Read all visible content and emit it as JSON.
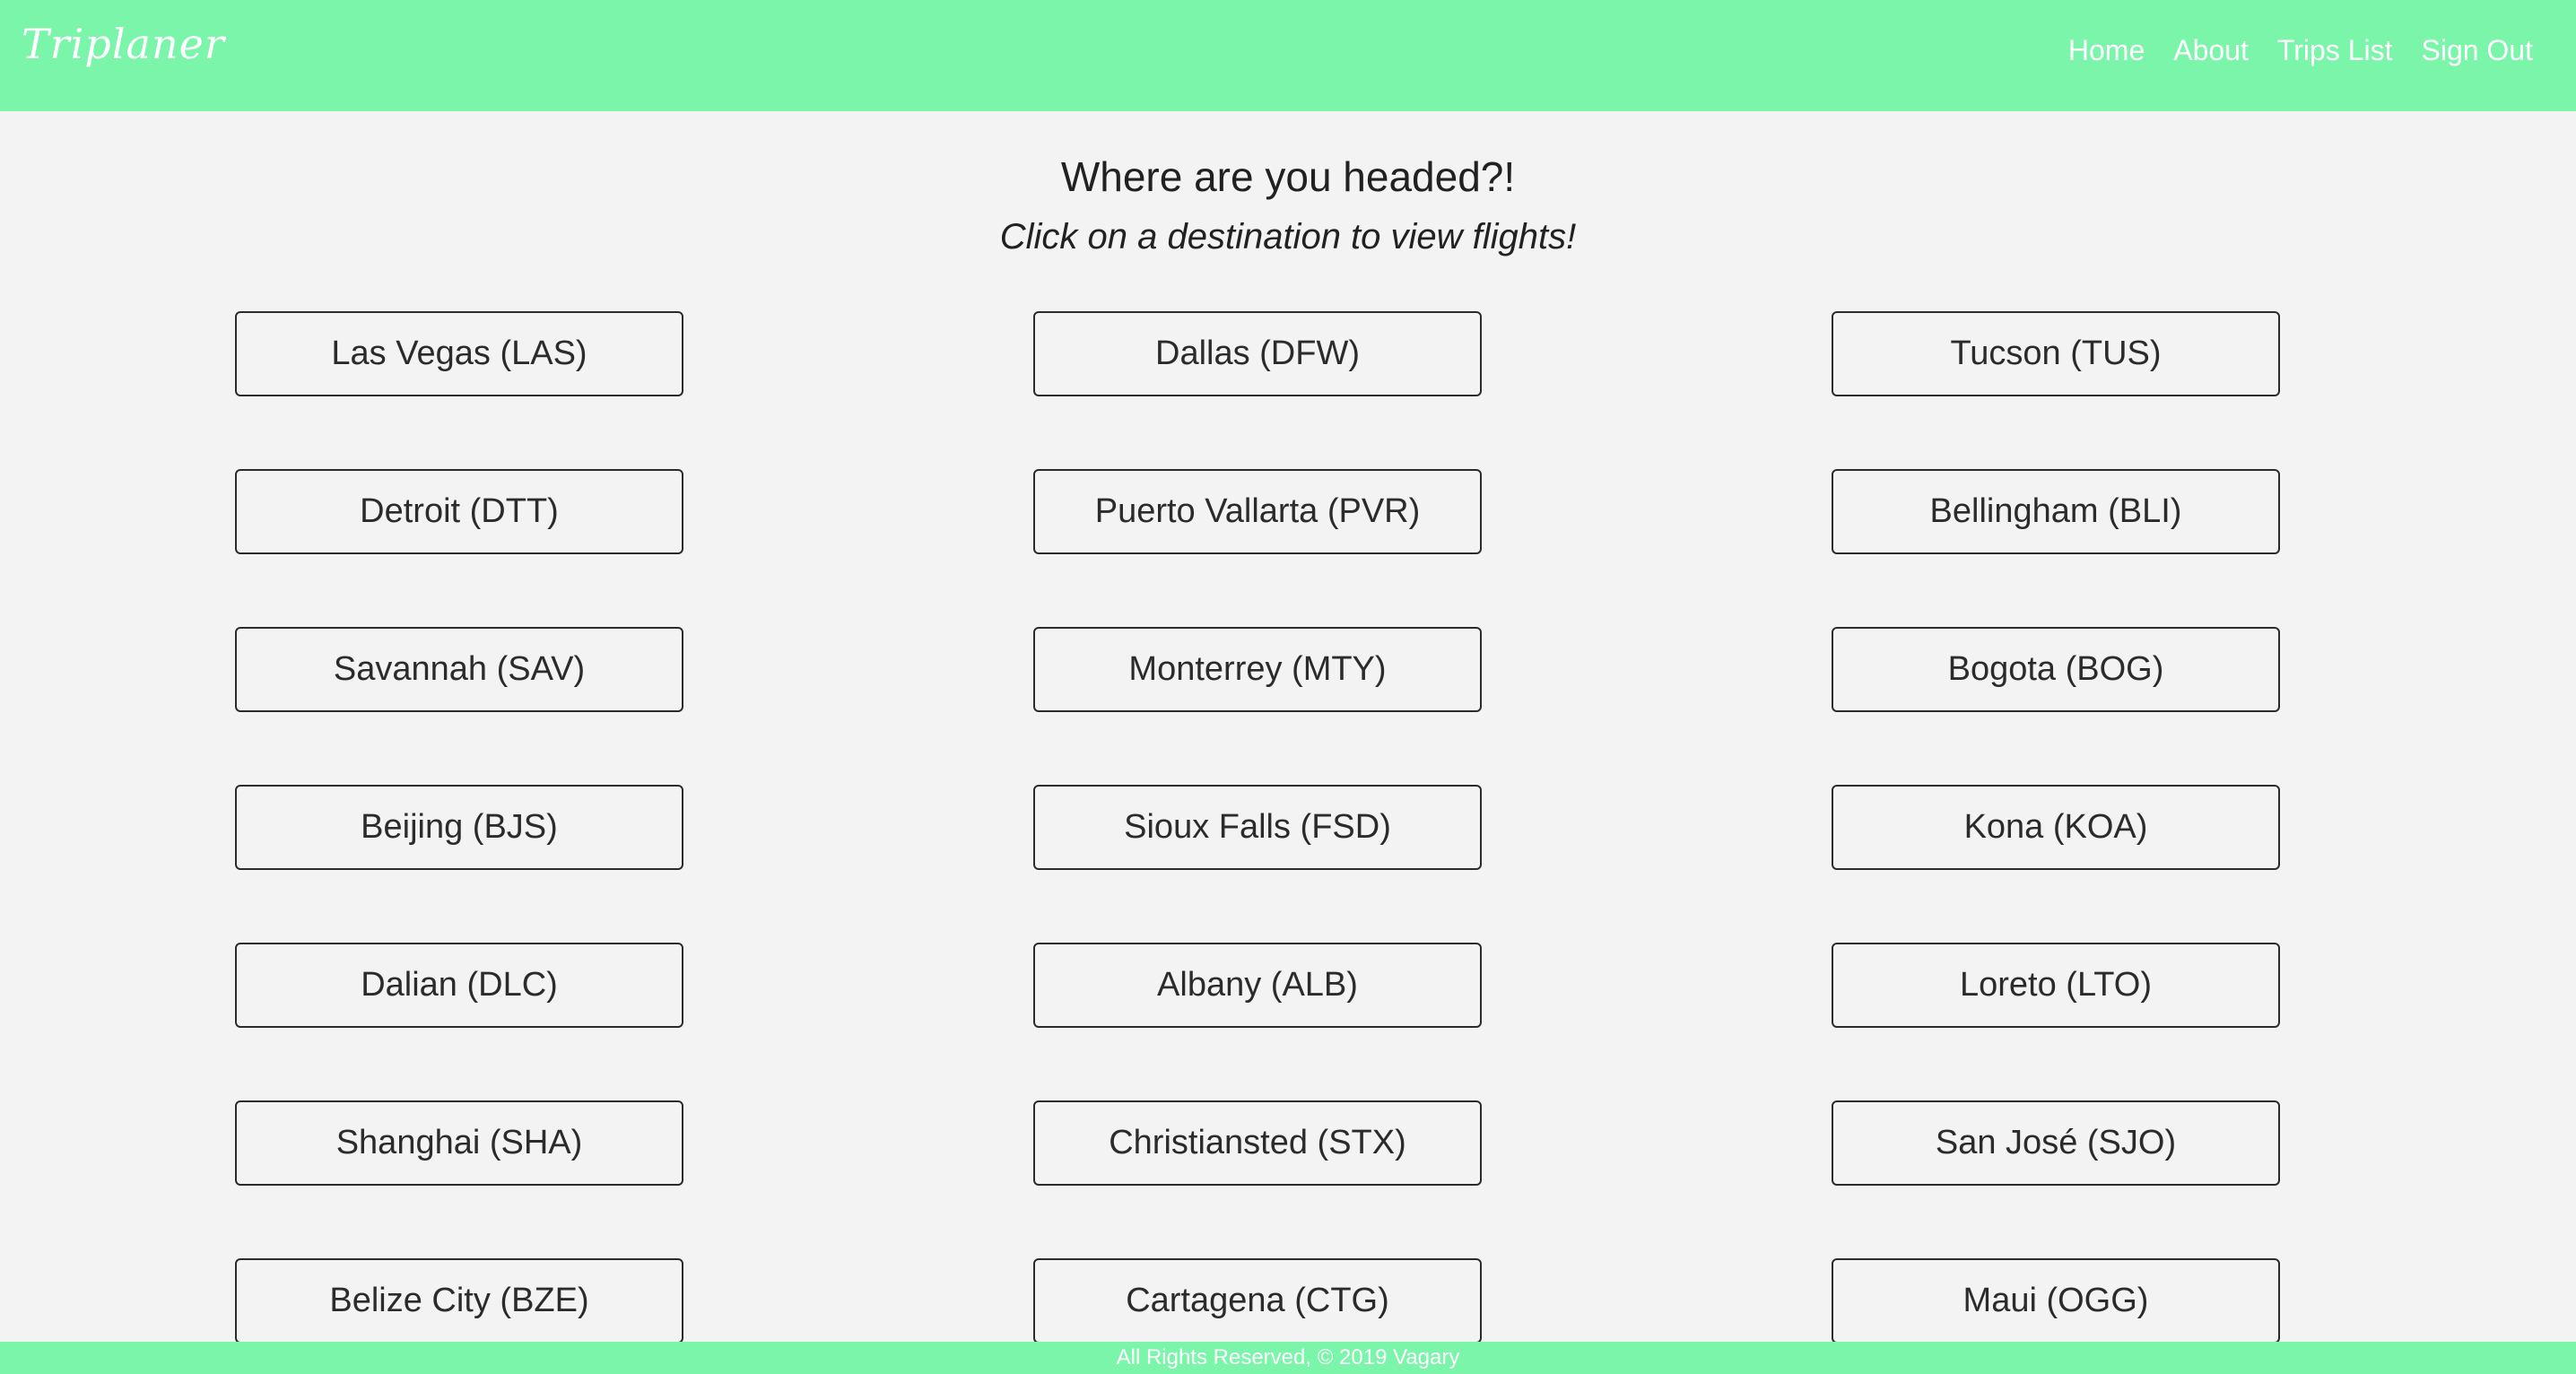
{
  "navbar": {
    "brand": "Triplaner",
    "links": [
      "Home",
      "About",
      "Trips List",
      "Sign Out"
    ],
    "background_color": "#7af5aa"
  },
  "main": {
    "heading": "Where are you headed?!",
    "subheading": "Click on a destination to view flights!",
    "destinations": [
      "Las Vegas (LAS)",
      "Dallas (DFW)",
      "Tucson (TUS)",
      "Detroit (DTT)",
      "Puerto Vallarta (PVR)",
      "Bellingham (BLI)",
      "Savannah (SAV)",
      "Monterrey (MTY)",
      "Bogota (BOG)",
      "Beijing (BJS)",
      "Sioux Falls (FSD)",
      "Kona (KOA)",
      "Dalian (DLC)",
      "Albany (ALB)",
      "Loreto (LTO)",
      "Shanghai (SHA)",
      "Christiansted (STX)",
      "San José (SJO)",
      "Belize City (BZE)",
      "Cartagena (CTG)",
      "Maui (OGG)"
    ]
  },
  "footer": {
    "text": "All Rights Reserved, © 2019 Vagary"
  }
}
